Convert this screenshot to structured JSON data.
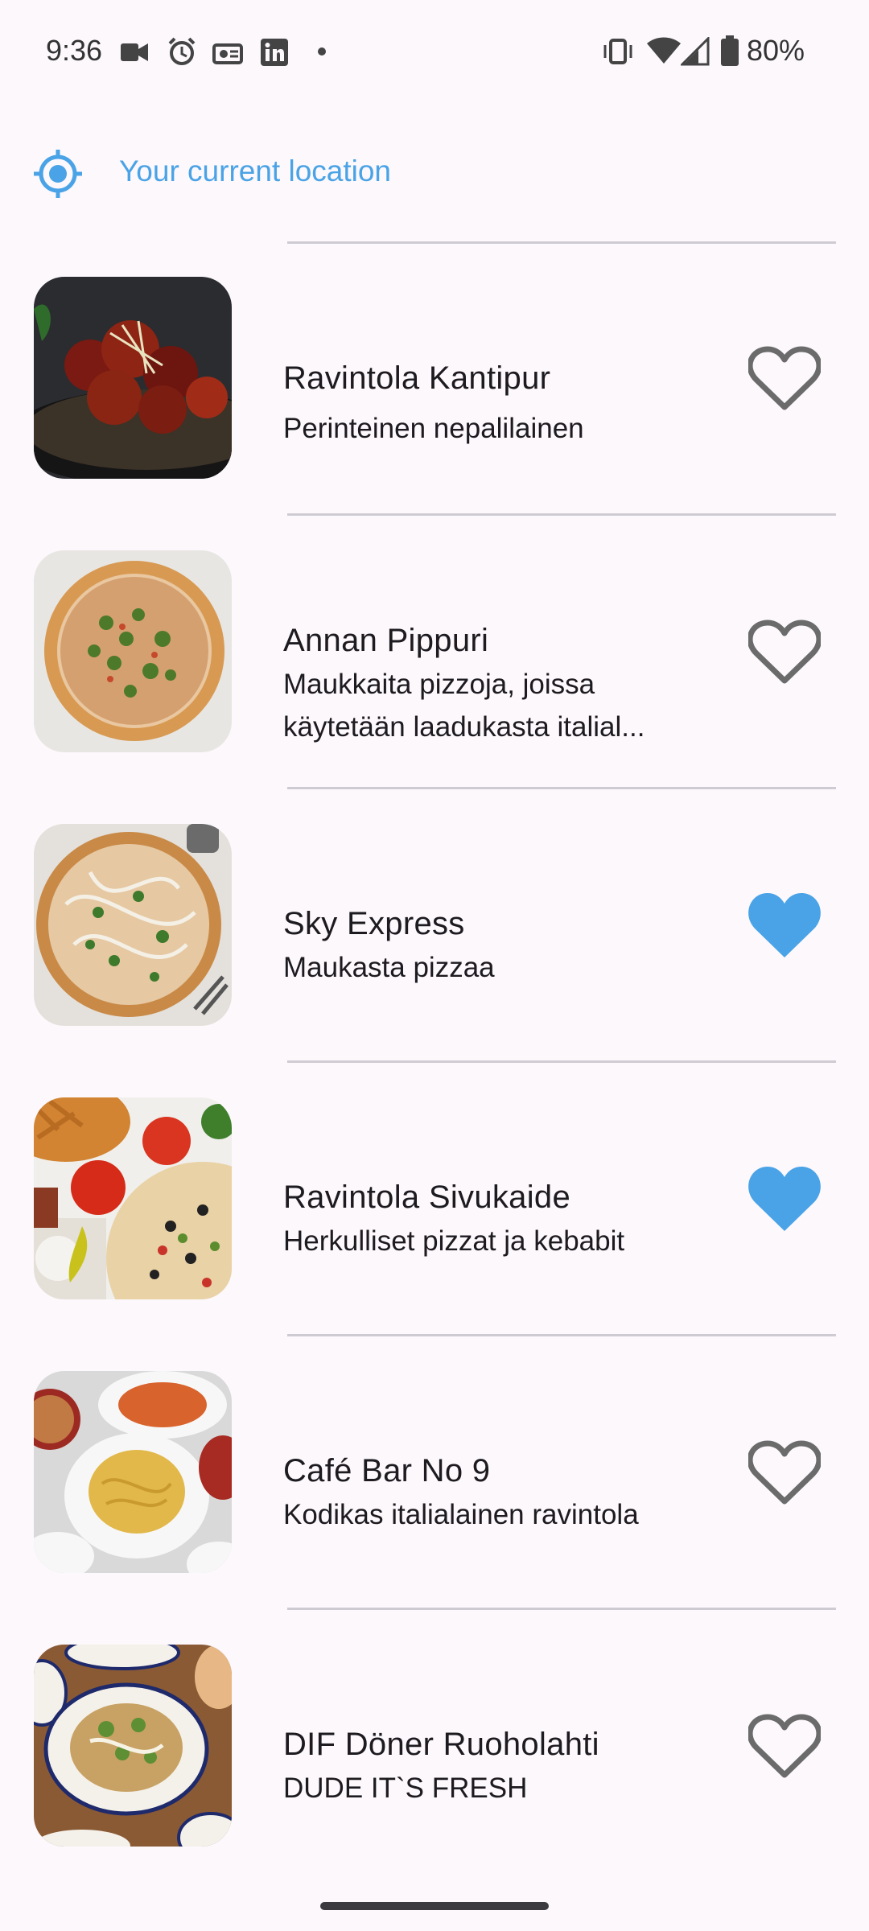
{
  "status_bar": {
    "time": "9:36",
    "battery": "80%",
    "icons": [
      "video-camera-icon",
      "alarm-icon",
      "cast-icon",
      "linkedin-icon",
      "dot-icon",
      "vibrate-icon",
      "wifi-icon",
      "signal-icon",
      "battery-icon"
    ]
  },
  "location": {
    "label": "Your current location",
    "icon": "my-location-icon",
    "accent": "#4aa3e6"
  },
  "restaurants": [
    {
      "name": "Ravintola Kantipur",
      "description": "Perinteinen nepalilainen",
      "favorite": false,
      "image": "spicy-chicken-dish"
    },
    {
      "name": "Annan Pippuri",
      "description": "Maukkaita pizzoja, joissa käytetään laadukasta italial...",
      "favorite": false,
      "image": "pizza-arugula"
    },
    {
      "name": "Sky Express",
      "description": "Maukasta pizzaa",
      "favorite": true,
      "image": "pizza-white-sauce"
    },
    {
      "name": "Ravintola Sivukaide",
      "description": "Herkulliset pizzat ja kebabit",
      "favorite": true,
      "image": "pizza-kebab-spread"
    },
    {
      "name": "Café Bar No 9",
      "description": "Kodikas italialainen ravintola",
      "favorite": false,
      "image": "pasta-dishes"
    },
    {
      "name": "DIF Döner Ruoholahti",
      "description": "DUDE IT`S FRESH",
      "favorite": false,
      "image": "doner-plates"
    }
  ],
  "colors": {
    "favorite_filled": "#4aa3e6",
    "favorite_outline": "#6b6b6b",
    "background": "#fcf8fc"
  }
}
